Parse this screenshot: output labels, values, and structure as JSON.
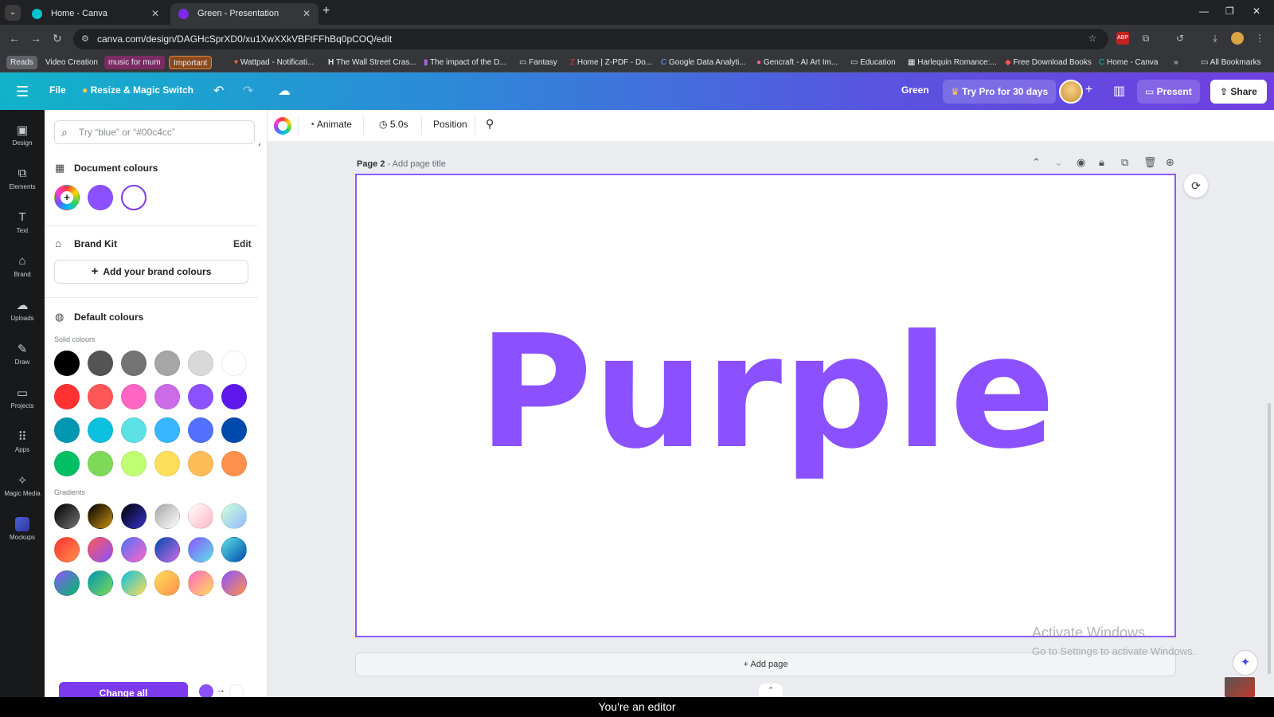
{
  "browser": {
    "tabs": [
      {
        "title": "Home - Canva",
        "close": "✕"
      },
      {
        "title": "Green - Presentation",
        "close": "✕"
      }
    ],
    "new_tab": "+",
    "url": "canva.com/design/DAGHcSprXD0/xu1XwXXkVBFtFFhBq0pCOQ/edit",
    "bookmarks": [
      {
        "label": "Reads",
        "bg": "#5f6368"
      },
      {
        "label": "Video Creation",
        "bg": ""
      },
      {
        "label": "music for mum",
        "bg": "#7b2b63"
      },
      {
        "label": "Important",
        "bg": "#8a4a1e"
      },
      {
        "label": "Wattpad - Notificati...",
        "bg": ""
      },
      {
        "label": "The Wall Street Cras...",
        "bg": ""
      },
      {
        "label": "The impact of the D...",
        "bg": ""
      },
      {
        "label": "Fantasy",
        "bg": ""
      },
      {
        "label": "Home | Z-PDF - Do...",
        "bg": ""
      },
      {
        "label": "Google Data Analyti...",
        "bg": ""
      },
      {
        "label": "Gencraft - AI Art Im...",
        "bg": ""
      },
      {
        "label": "Education",
        "bg": ""
      },
      {
        "label": "Harlequin Romance:...",
        "bg": ""
      },
      {
        "label": "Free Download Books",
        "bg": ""
      },
      {
        "label": "Home - Canva",
        "bg": ""
      },
      {
        "label": "»",
        "bg": ""
      },
      {
        "label": "All Bookmarks",
        "bg": ""
      }
    ]
  },
  "header": {
    "file": "File",
    "resize": "Resize & Magic Switch",
    "doc_name": "Green",
    "try_pro": "Try Pro for 30 days",
    "present": "Present",
    "share": "Share"
  },
  "rail": [
    {
      "label": "Design",
      "icon": "▣"
    },
    {
      "label": "Elements",
      "icon": "⧉"
    },
    {
      "label": "Text",
      "icon": "T"
    },
    {
      "label": "Brand",
      "icon": "⌂"
    },
    {
      "label": "Uploads",
      "icon": "☁"
    },
    {
      "label": "Draw",
      "icon": "✎"
    },
    {
      "label": "Projects",
      "icon": "▭"
    },
    {
      "label": "Apps",
      "icon": "⠿"
    },
    {
      "label": "Magic Media",
      "icon": "✧"
    },
    {
      "label": "Mockups",
      "icon": ""
    }
  ],
  "panel": {
    "search_placeholder": "Try “blue” or “#00c4cc”",
    "document_colours": "Document colours",
    "brand_kit": "Brand Kit",
    "edit": "Edit",
    "add_brand": "Add your brand colours",
    "default_colours": "Default colours",
    "solid_colours": "Solid colours",
    "gradients": "Gradients",
    "change_all": "Change all",
    "doc_swatches": [
      "#8b50ff",
      "#ffffff"
    ],
    "solid": [
      [
        "#000000",
        "#545454",
        "#737373",
        "#a6a6a6",
        "#d9d9d9",
        "#ffffff"
      ],
      [
        "#ff3131",
        "#ff5757",
        "#ff66c4",
        "#cb6ce6",
        "#8c52ff",
        "#5e17eb"
      ],
      [
        "#0097b2",
        "#0cc0df",
        "#5ce1e6",
        "#38b6ff",
        "#5271ff",
        "#004aad"
      ],
      [
        "#00bf63",
        "#7ed957",
        "#c1ff72",
        "#ffde59",
        "#ffbd59",
        "#ff914d"
      ]
    ],
    "gradient_rows": [
      [
        [
          "#000000",
          "#737373"
        ],
        [
          "#000000",
          "#c89116"
        ],
        [
          "#000000",
          "#3533cd"
        ],
        [
          "#a6a6a6",
          "#ffffff"
        ],
        [
          "#ffffff",
          "#ffb6c1"
        ],
        [
          "#cdffd8",
          "#94b9ff"
        ]
      ],
      [
        [
          "#ff3131",
          "#ff914d"
        ],
        [
          "#ff5757",
          "#8c52ff"
        ],
        [
          "#5170ff",
          "#ff66c4"
        ],
        [
          "#004aad",
          "#cb6ce6"
        ],
        [
          "#8c52ff",
          "#5ce1e6"
        ],
        [
          "#5de0e6",
          "#004aad"
        ]
      ],
      [
        [
          "#8c52ff",
          "#00bf63"
        ],
        [
          "#0097b2",
          "#7ed957"
        ],
        [
          "#0cc0df",
          "#ffde59"
        ],
        [
          "#ffde59",
          "#ff914d"
        ],
        [
          "#ff66c4",
          "#ffde59"
        ],
        [
          "#8c52ff",
          "#ff914d"
        ]
      ]
    ]
  },
  "toolbar": {
    "animate": "Animate",
    "duration": "5.0s",
    "position": "Position"
  },
  "canvas": {
    "page_label": "Page 2",
    "page_title_placeholder": "- Add page title",
    "text": "Purple",
    "text_color": "#8b50ff",
    "add_page": "+ Add page",
    "watermark_title": "Activate Windows",
    "watermark_sub": "Go to Settings to activate Windows."
  },
  "caption": "You're an editor"
}
